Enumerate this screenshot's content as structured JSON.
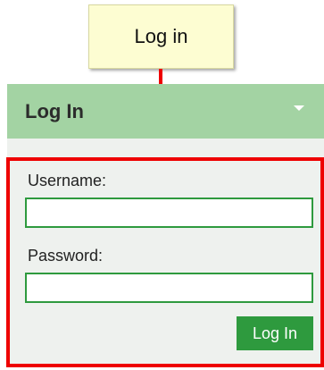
{
  "callout": {
    "label": "Log in"
  },
  "panel": {
    "title": "Log In",
    "collapse_icon": "chevron-down-icon"
  },
  "form": {
    "username_label": "Username:",
    "username_value": "",
    "password_label": "Password:",
    "password_value": "",
    "submit_label": "Log In"
  },
  "colors": {
    "header_bg": "#a3d3a3",
    "highlight_border": "#ee0000",
    "button_bg": "#2e9a3e",
    "callout_bg": "#fdfdd2"
  }
}
